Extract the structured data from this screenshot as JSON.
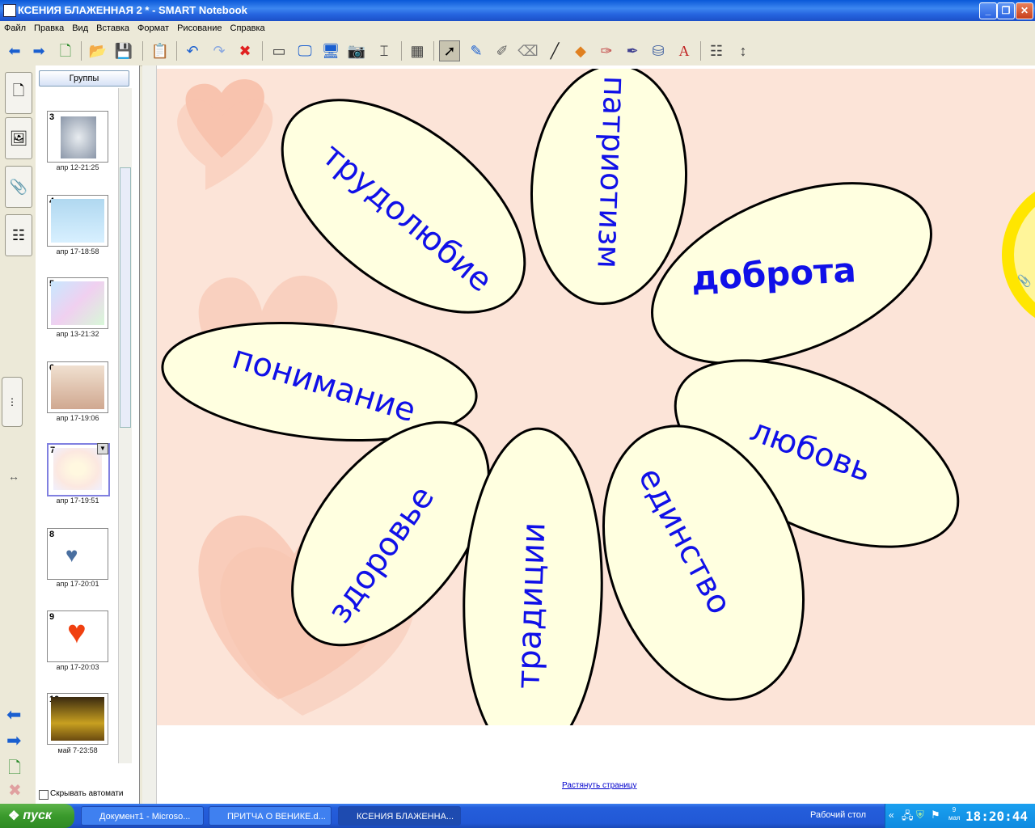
{
  "window": {
    "title": "КСЕНИЯ БЛАЖЕННАЯ 2 * - SMART Notebook",
    "controls": [
      "_",
      "❐",
      "✕"
    ]
  },
  "menu": [
    "Файл",
    "Правка",
    "Вид",
    "Вставка",
    "Формат",
    "Рисование",
    "Справка"
  ],
  "toolbar": {
    "icons": [
      "back-icon",
      "forward-icon",
      "add-page-icon",
      "open-folder-icon",
      "save-icon",
      "paste-icon",
      "undo-icon",
      "redo-icon",
      "delete-icon",
      "screen-shade-icon",
      "full-screen-icon",
      "dual-page-icon",
      "capture-icon",
      "document-camera-icon",
      "table-icon",
      "select-icon",
      "pen-icon",
      "creative-pen-icon",
      "eraser-icon",
      "line-icon",
      "shapes-icon",
      "magic-pen-icon",
      "pen-star-icon",
      "fill-icon",
      "text-icon",
      "properties-icon",
      "move-toolbar-icon"
    ]
  },
  "sorter": {
    "groups_label": "Группы",
    "hide_label": "Скрывать автомати",
    "thumbnails": [
      {
        "num": "3",
        "date": "апр 12-21:25"
      },
      {
        "num": "4",
        "date": "апр 17-18:58"
      },
      {
        "num": "5",
        "date": "апр 13-21:32"
      },
      {
        "num": "6",
        "date": "апр 17-19:06"
      },
      {
        "num": "7",
        "date": "апр 17-19:51"
      },
      {
        "num": "8",
        "date": "апр 17-20:01"
      },
      {
        "num": "9",
        "date": "апр 17-20:03"
      },
      {
        "num": "10",
        "date": "май 7-23:58"
      }
    ]
  },
  "canvas": {
    "petals": [
      "трудолюбие",
      "патриотизм",
      "доброта",
      "понимание",
      "любовь",
      "здоровье",
      "традиции",
      "единство"
    ],
    "stretch_link": "Растянуть страницу",
    "colors": {
      "background": "#fce4d8",
      "petal_fill": "#ffffe0",
      "petal_text": "#1010e8",
      "heart": "#f4a88c"
    }
  },
  "taskbar": {
    "start": "пуск",
    "tasks": [
      "Документ1 - Microso...",
      "ПРИТЧА О ВЕНИКЕ.d...",
      "КСЕНИЯ БЛАЖЕННА..."
    ],
    "desktop_label": "Рабочий стол",
    "clock": "18:20:44",
    "date_small": "9 мая"
  }
}
